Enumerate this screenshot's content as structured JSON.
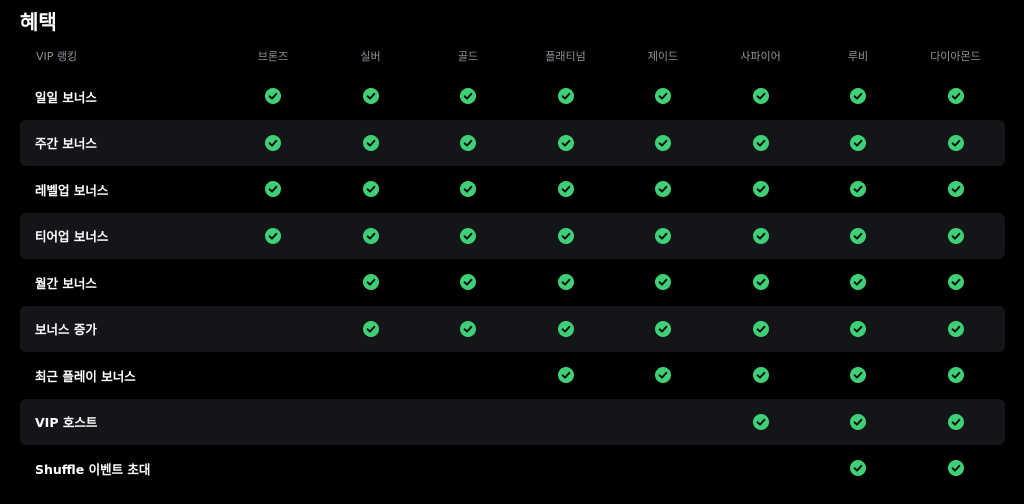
{
  "title": "혜택",
  "table": {
    "header_label": "VIP 랭킹",
    "tiers": [
      "브론즈",
      "실버",
      "골드",
      "플래티넘",
      "제이드",
      "사파이어",
      "루비",
      "다이아몬드"
    ],
    "rows": [
      {
        "name": "일일 보너스",
        "included": [
          true,
          true,
          true,
          true,
          true,
          true,
          true,
          true
        ]
      },
      {
        "name": "주간 보너스",
        "included": [
          true,
          true,
          true,
          true,
          true,
          true,
          true,
          true
        ]
      },
      {
        "name": "레벨업 보너스",
        "included": [
          true,
          true,
          true,
          true,
          true,
          true,
          true,
          true
        ]
      },
      {
        "name": "티어업 보너스",
        "included": [
          true,
          true,
          true,
          true,
          true,
          true,
          true,
          true
        ]
      },
      {
        "name": "월간 보너스",
        "included": [
          false,
          true,
          true,
          true,
          true,
          true,
          true,
          true
        ]
      },
      {
        "name": "보너스 증가",
        "included": [
          false,
          true,
          true,
          true,
          true,
          true,
          true,
          true
        ]
      },
      {
        "name": "최근 플레이 보너스",
        "included": [
          false,
          false,
          false,
          true,
          true,
          true,
          true,
          true
        ]
      },
      {
        "name": "VIP 호스트",
        "included": [
          false,
          false,
          false,
          false,
          false,
          true,
          true,
          true
        ]
      },
      {
        "name": "Shuffle 이벤트 초대",
        "included": [
          false,
          false,
          false,
          false,
          false,
          false,
          true,
          true
        ]
      }
    ]
  },
  "colors": {
    "check": "#3fd077",
    "check_mark": "#0b0c0e",
    "row_stripe": "#131519",
    "header_text": "#8e939c"
  },
  "icons": {
    "included": "check-circle-icon"
  }
}
